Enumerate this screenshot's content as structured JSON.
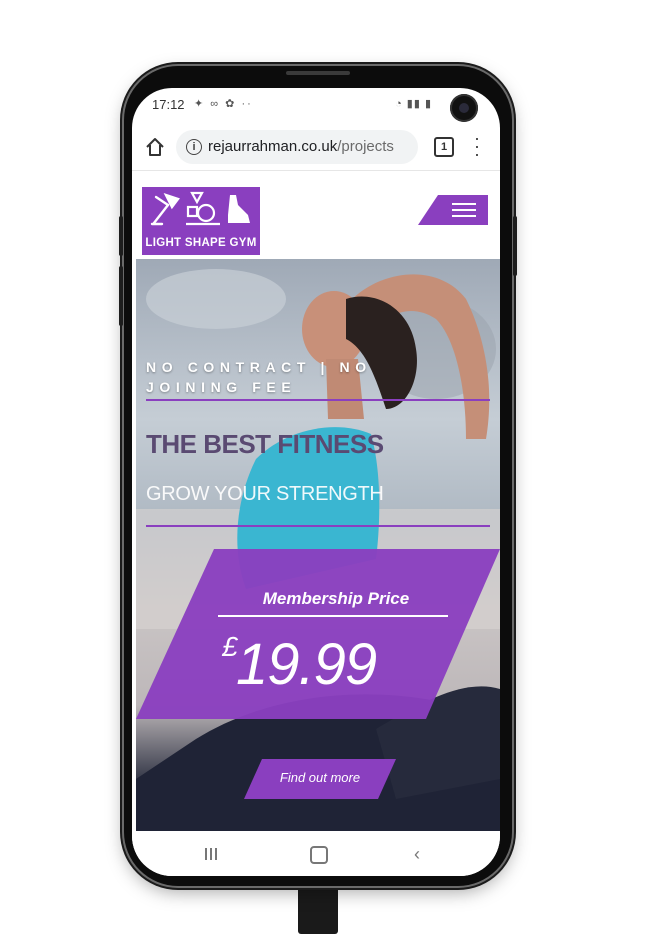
{
  "status_bar": {
    "time": "17:12",
    "left_icons": "✦ ∞ ✿ ··",
    "right_icons": "◔ ▮▮ ▮"
  },
  "browser": {
    "url_domain": "rejaurrahman.co.uk",
    "url_path": "/projects",
    "tabs_count": "1",
    "info_icon": "i"
  },
  "site": {
    "logo_text": "LIGHT SHAPE GYM",
    "tagline": "NO CONTRACT | NO JOINING FEE",
    "headline": "THE BEST FITNESS",
    "subheadline": "GROW YOUR STRENGTH",
    "price_label": "Membership Price",
    "price_currency": "£",
    "price_value": "19.99",
    "cta_label": "Find out more"
  },
  "icons": {
    "home": "home-icon",
    "info": "info-icon",
    "tabs": "tabs-icon",
    "more": "more-vert-icon",
    "hamburger": "hamburger-menu-icon",
    "recents": "recents-icon",
    "nav_home": "nav-home-icon",
    "back": "back-icon"
  },
  "colors": {
    "brand_purple": "#8a3fbf",
    "headline_color": "#5a4a72"
  }
}
